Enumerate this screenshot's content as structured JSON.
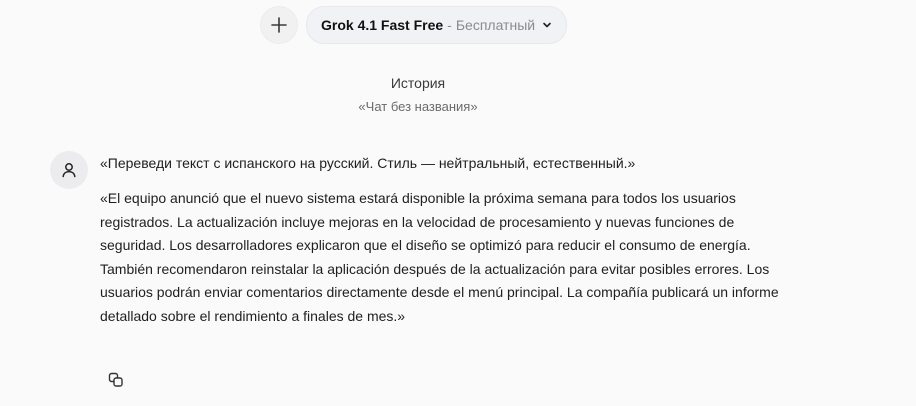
{
  "header": {
    "new_chat_icon": "plus-icon",
    "model_name": "Grok 4.1 Fast Free",
    "model_separator": " - ",
    "model_tier": "Бесплатный",
    "dropdown_icon": "chevron-down-icon"
  },
  "history": {
    "title": "История",
    "chat_name": "«Чат без названия»"
  },
  "message": {
    "avatar_icon": "user-icon",
    "instruction": "«Переведи текст с испанского на русский. Стиль — нейтральный, естественный.»",
    "body": "«El equipo anunció que el nuevo sistema estará disponible la próxima semana para todos los usuarios registrados. La actualización incluye mejoras en la velocidad de procesamiento y nuevas funciones de seguridad. Los desarrolladores explicaron que el diseño se optimizó para reducir el consumo de energía. También recomendaron reinstalar la aplicación después de la actualización para evitar posibles errores. Los usuarios podrán enviar comentarios directamente desde el menú principal. La compañía publicará un informe detallado sobre el rendimiento a finales de mes.»",
    "copy_icon": "copy-icon"
  },
  "colors": {
    "background": "#fafafa",
    "pill_background": "#f1f2f5",
    "muted_text": "#8a8a8f"
  }
}
